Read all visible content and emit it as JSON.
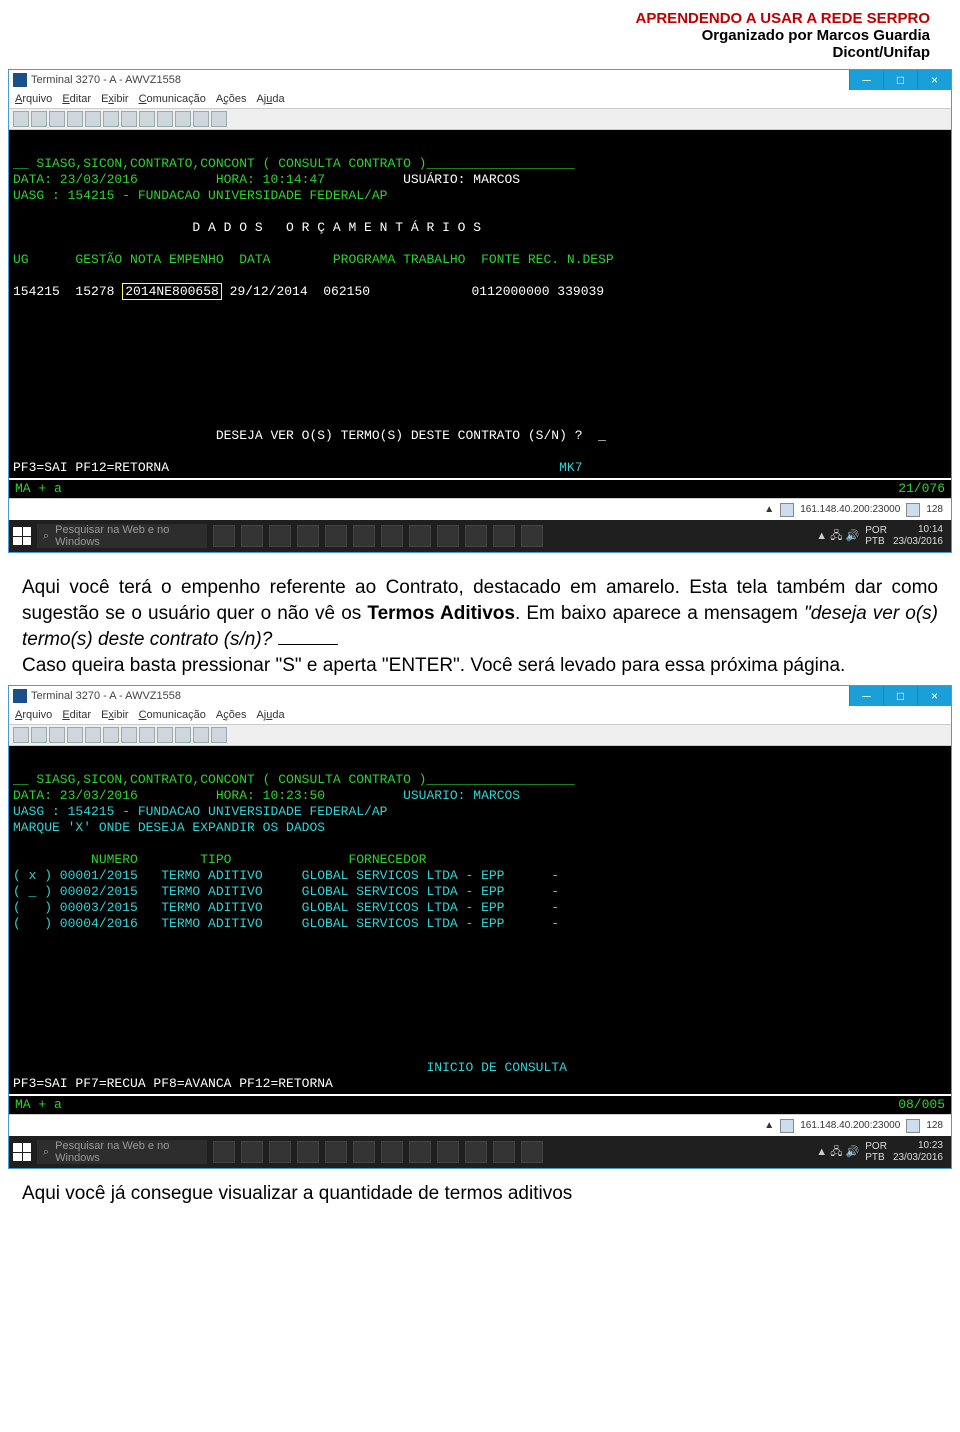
{
  "header": {
    "line1": "APRENDENDO A USAR A REDE SERPRO",
    "line2": "Organizado por Marcos Guardia",
    "line3": "Dicont/Unifap"
  },
  "term_common": {
    "window_title": "Terminal 3270 - A - AWVZ1558",
    "menu": [
      "Arquivo",
      "Editar",
      "Exibir",
      "Comunicação",
      "Ações",
      "Ajuda"
    ],
    "status_left": "MA  +   a",
    "sys_ip": "161.148.40.200:23000",
    "sys_num": "128"
  },
  "term1": {
    "lines": {
      "l1a": "__ SIASG,SICON,CONTRATO,CONCONT ( CONSULTA CONTRATO )___________________",
      "l2a": "DATA: 23/03/2016          HORA: 10:14:47          ",
      "l2b": "USUÁRIO: MARCOS",
      "l3": "UASG : 154215 - FUNDACAO UNIVERSIDADE FEDERAL/AP",
      "head": "                       D A D O S   O R Ç A M E N T Á R I O S",
      "cols": "UG      GESTÃO NOTA EMPENHO  DATA        PROGRAMA TRABALHO  FONTE REC. N.DESP",
      "row_a": "154215  15278 ",
      "row_hl": "2014NE800658",
      "row_b": " 29/12/2014  062150             0112000000 339039",
      "ask": "                          DESEJA VER O(S) TERMO(S) DESTE CONTRATO (S/N) ?  _",
      "pf": "PF3=SAI PF12=RETORNA",
      "mk": "MK7"
    },
    "status_right": "21/076",
    "clock": {
      "t": "10:14",
      "d": "23/03/2016",
      "lang": "POR",
      "kb": "PTB"
    }
  },
  "term2": {
    "lines": {
      "l1a": "__ SIASG,SICON,CONTRATO,CONCONT ( CONSULTA CONTRATO )___________________",
      "l2a": "DATA: 23/03/2016          HORA: 10:23:50          ",
      "l2b": "USUARIO: MARCOS",
      "l3": "UASG : 154215 - FUNDACAO UNIVERSIDADE FEDERAL/AP",
      "l4": "MARQUE 'X' ONDE DESEJA EXPANDIR OS DADOS",
      "hdr": "          NUMERO        TIPO               FORNECEDOR",
      "r1": "( x ) 00001/2015   TERMO ADITIVO     GLOBAL SERVICOS LTDA - EPP      -",
      "r2": "( _ ) 00002/2015   TERMO ADITIVO     GLOBAL SERVICOS LTDA - EPP      -",
      "r3": "(   ) 00003/2015   TERMO ADITIVO     GLOBAL SERVICOS LTDA - EPP      -",
      "r4": "(   ) 00004/2016   TERMO ADITIVO     GLOBAL SERVICOS LTDA - EPP      -",
      "ini": "                                                     INICIO DE CONSULTA",
      "pf": "PF3=SAI PF7=RECUA PF8=AVANCA PF12=RETORNA"
    },
    "status_right": "08/005",
    "clock": {
      "t": "10:23",
      "d": "23/03/2016",
      "lang": "POR",
      "kb": "PTB"
    }
  },
  "para1": {
    "a": "Aqui você terá o empenho referente ao Contrato, destacado em amarelo. Esta tela também dar como sugestão se o usuário quer o não vê os ",
    "b": "Termos Aditivos",
    "c": ". Em baixo aparece a mensagem ",
    "d": "\"deseja ver o(s) termo(s) deste contrato (s/n)?",
    "e": "Caso queira basta pressionar \"S\" e aperta \"ENTER\". Você será levado para essa próxima página."
  },
  "para2": "Aqui você já consegue visualizar a quantidade de termos aditivos",
  "taskbar": {
    "search_ph": "Pesquisar na Web e no Windows"
  }
}
